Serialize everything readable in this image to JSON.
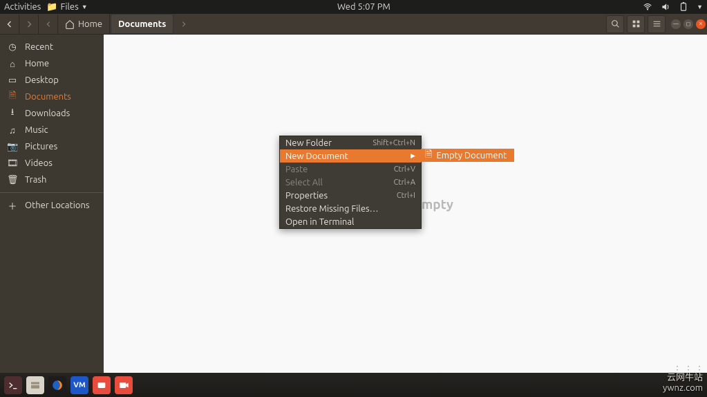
{
  "panel": {
    "activities": "Activities",
    "app_menu": "Files",
    "clock": "Wed  5:07 PM"
  },
  "toolbar": {
    "home_label": "Home",
    "current_label": "Documents"
  },
  "sidebar": {
    "items": [
      {
        "icon": "◷",
        "label": "Recent",
        "active": false
      },
      {
        "icon": "⌂",
        "label": "Home",
        "active": false
      },
      {
        "icon": "▭",
        "label": "Desktop",
        "active": false
      },
      {
        "icon": "🗎",
        "label": "Documents",
        "active": true
      },
      {
        "icon": "⭳",
        "label": "Downloads",
        "active": false
      },
      {
        "icon": "♫",
        "label": "Music",
        "active": false
      },
      {
        "icon": "📷",
        "label": "Pictures",
        "active": false
      },
      {
        "icon": "🎞",
        "label": "Videos",
        "active": false
      },
      {
        "icon": "🗑",
        "label": "Trash",
        "active": false
      }
    ],
    "other": {
      "icon": "＋",
      "label": "Other Locations"
    }
  },
  "content": {
    "empty_text": "Folder Is Empty"
  },
  "context_menu": {
    "items": [
      {
        "label": "New Folder",
        "shortcut": "Shift+Ctrl+N",
        "hl": false,
        "dis": false
      },
      {
        "label": "New Document",
        "shortcut": "",
        "hl": true,
        "dis": false,
        "submenu": true
      },
      {
        "label": "Paste",
        "shortcut": "Ctrl+V",
        "hl": false,
        "dis": true
      },
      {
        "label": "Select All",
        "shortcut": "Ctrl+A",
        "hl": false,
        "dis": true
      },
      {
        "label": "Properties",
        "shortcut": "Ctrl+I",
        "hl": false,
        "dis": false
      },
      {
        "label": "Restore Missing Files…",
        "shortcut": "",
        "hl": false,
        "dis": false
      },
      {
        "label": "Open in Terminal",
        "shortcut": "",
        "hl": false,
        "dis": false
      }
    ],
    "submenu_item": "Empty Document"
  },
  "watermark": {
    "line1": "云网牛站",
    "line2": "ywnz.com"
  }
}
